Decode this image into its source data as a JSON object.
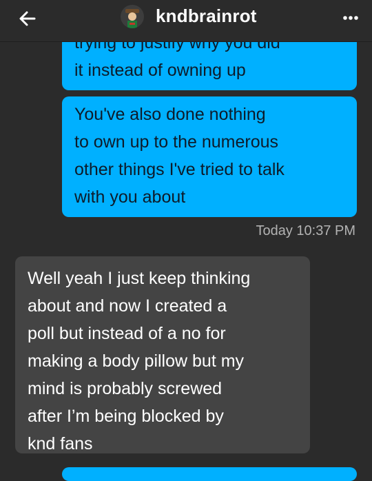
{
  "header": {
    "title": "kndbrainrot",
    "back_icon": "back-arrow-icon",
    "more_icon": "more-dots-icon",
    "avatar_icon": "avatar"
  },
  "messages": {
    "out1": {
      "line0": "trying to justify why you did",
      "line1": "it instead of owning up"
    },
    "out2": {
      "lines": [
        "You've also done nothing",
        "to own up to the numerous",
        "other things I've tried to talk",
        "with you about"
      ]
    },
    "timestamp": "Today 10:37 PM",
    "in1": {
      "lines": [
        "Well yeah I just keep thinking",
        "about and now I created a",
        "poll but instead of a no for",
        "making a body pillow but my",
        "mind is probably screwed",
        "after I’m being blocked by",
        "knd fans"
      ]
    }
  },
  "colors": {
    "background": "#2b2b2b",
    "outgoing_bubble": "#00b0ff",
    "incoming_bubble": "#444444"
  }
}
